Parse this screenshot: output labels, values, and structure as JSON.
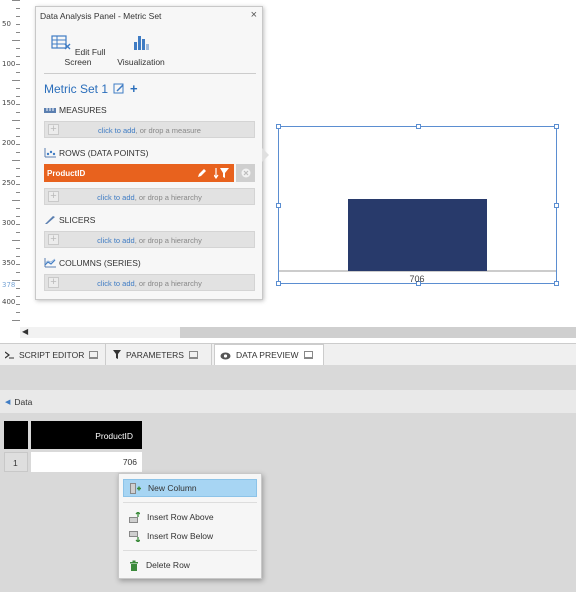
{
  "ruler": {
    "labels": [
      "50",
      "100",
      "150",
      "200",
      "250",
      "300",
      "350",
      "378",
      "400"
    ]
  },
  "panel": {
    "title": "Data Analysis Panel - Metric Set",
    "close_label": "×",
    "toolbar": {
      "edit_full_screen": "Edit Full Screen",
      "visualization": "Visualization"
    },
    "metric_set_title": "Metric Set 1",
    "add_label": "+",
    "sections": {
      "measures": {
        "label": "MEASURES",
        "drop_link": "click to add",
        "drop_text": ", or drop a measure"
      },
      "rows": {
        "label": "ROWS (DATA POINTS)",
        "item": "ProductID",
        "drop_link": "click to add",
        "drop_text": ", or drop a hierarchy"
      },
      "slicers": {
        "label": "SLICERS",
        "drop_link": "click to add",
        "drop_text": ", or drop a hierarchy"
      },
      "columns": {
        "label": "COLUMNS (SERIES)",
        "drop_link": "click to add",
        "drop_text": ", or drop a hierarchy"
      }
    },
    "plus_symbol": "+"
  },
  "chart": {
    "categories": [
      "706"
    ],
    "bar_color": "#283a6b"
  },
  "scroll": {
    "left_arrow": "◀"
  },
  "tabs": [
    {
      "label": "SCRIPT EDITOR",
      "icon": "terminal-icon"
    },
    {
      "label": "PARAMETERS",
      "icon": "filter-icon"
    },
    {
      "label": "DATA PREVIEW",
      "icon": "eye-icon",
      "active": true
    }
  ],
  "data_preview": {
    "back_label": "Data",
    "back_arrow": "◀",
    "column_header": "ProductID",
    "rows": [
      {
        "num": "1",
        "value": "706"
      }
    ]
  },
  "context_menu": {
    "items": {
      "new_column": "New Column",
      "insert_row_above": "Insert Row Above",
      "insert_row_below": "Insert Row Below",
      "delete_row": "Delete Row"
    }
  },
  "colors": {
    "accent_orange": "#e8621e",
    "link_blue": "#2a6ebb",
    "highlight": "#a7d5f3"
  }
}
